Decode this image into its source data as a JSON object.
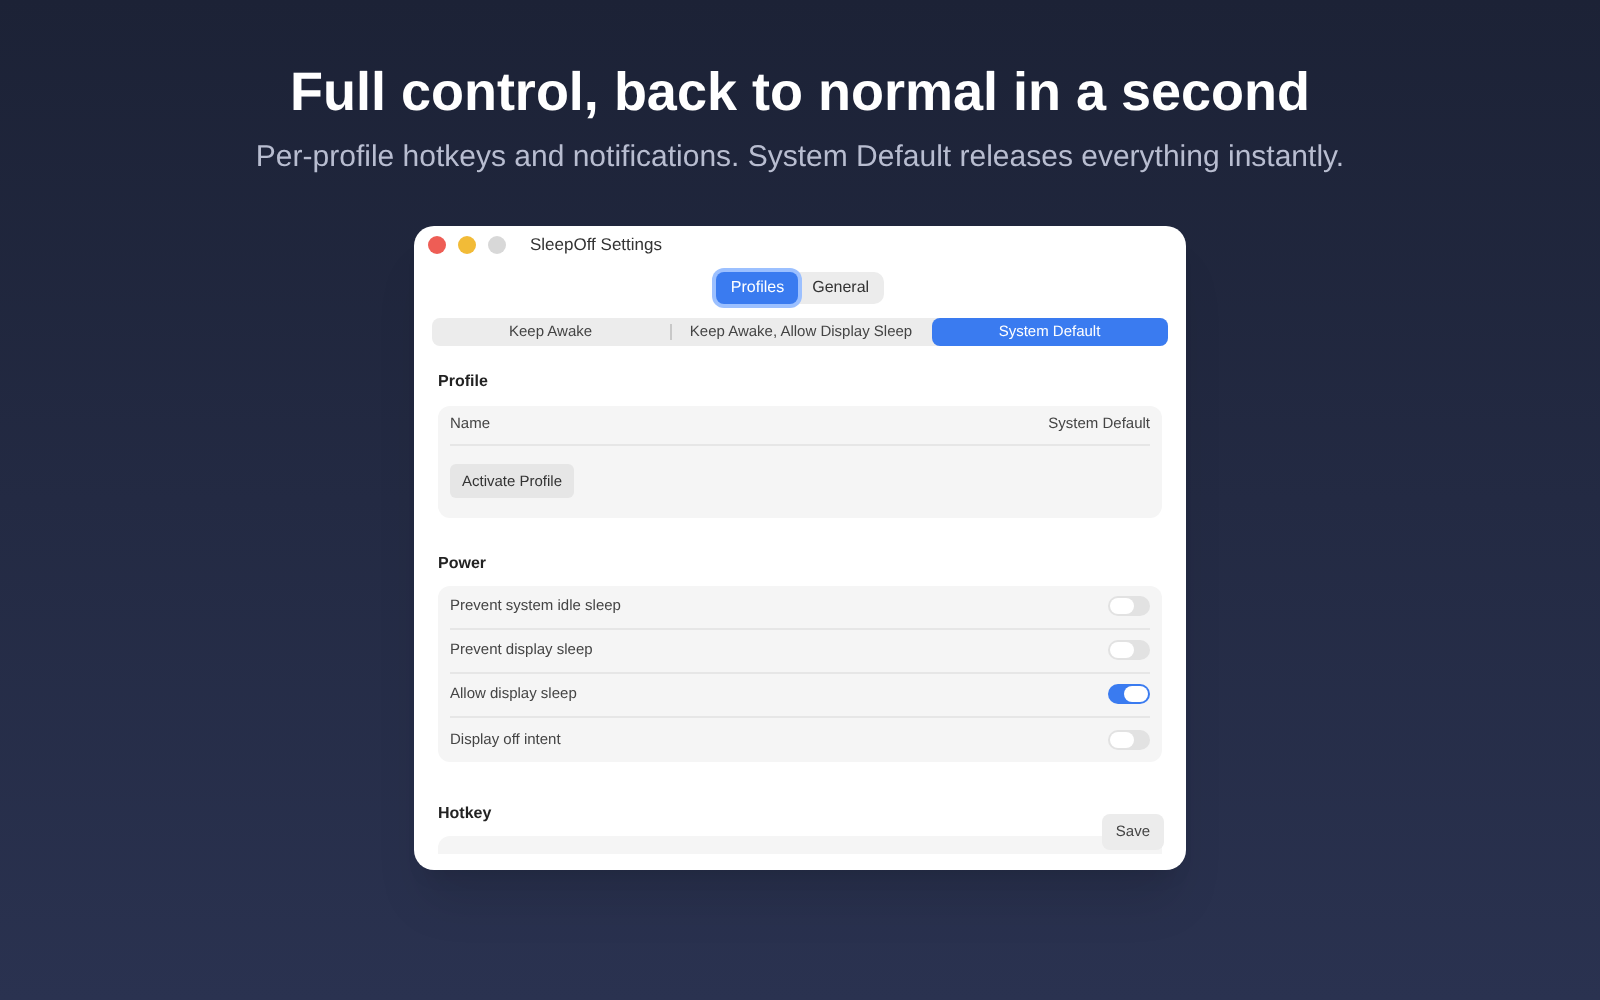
{
  "headline": "Full control, back to normal in a second",
  "subheadline": "Per-profile hotkeys and notifications. System Default releases everything instantly.",
  "window": {
    "title": "SleepOff Settings"
  },
  "tabs": [
    {
      "label": "Profiles",
      "selected": true
    },
    {
      "label": "General",
      "selected": false
    }
  ],
  "profiles": [
    {
      "label": "Keep Awake",
      "selected": false
    },
    {
      "label": "Keep Awake, Allow Display Sleep",
      "selected": false
    },
    {
      "label": "System Default",
      "selected": true
    }
  ],
  "profile_section": {
    "title": "Profile",
    "name_label": "Name",
    "name_value": "System Default",
    "button": "Activate Profile"
  },
  "power_section": {
    "title": "Power",
    "rows": [
      {
        "label": "Prevent system idle sleep",
        "on": false
      },
      {
        "label": "Prevent display sleep",
        "on": false
      },
      {
        "label": "Allow display sleep",
        "on": true
      },
      {
        "label": "Display off intent",
        "on": false
      }
    ]
  },
  "hotkey_section": {
    "title": "Hotkey"
  },
  "save_button": "Save"
}
